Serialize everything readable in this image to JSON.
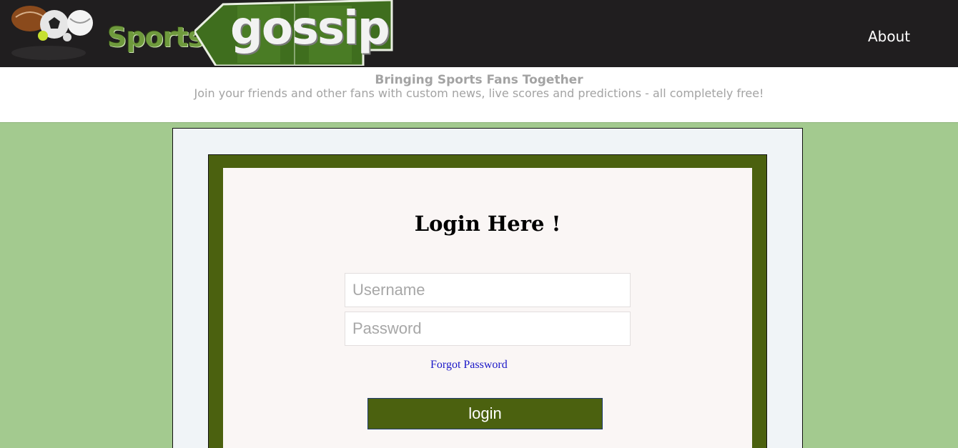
{
  "header": {
    "logo_word_1": "Sports",
    "logo_word_2": "gossip",
    "nav": {
      "about_label": "About"
    }
  },
  "tagline": {
    "title": "Bringing Sports Fans Together",
    "subtitle": "Join your friends and other fans with custom news, live scores and predictions - all completely free!"
  },
  "login": {
    "heading": "Login Here !",
    "username_placeholder": "Username",
    "password_placeholder": "Password",
    "forgot_label": "Forgot Password",
    "submit_label": "login"
  },
  "icons": {
    "logo_balls": "sports-balls-icon",
    "logo_pitch": "pitch-background-icon"
  },
  "colors": {
    "topbar": "#201e1f",
    "page_background": "#a3ca8f",
    "brand_green": "#4b610f",
    "logo_green": "#6f9a3d",
    "link_blue": "#1a17c8",
    "tagline_gray": "#a3a3a3"
  }
}
